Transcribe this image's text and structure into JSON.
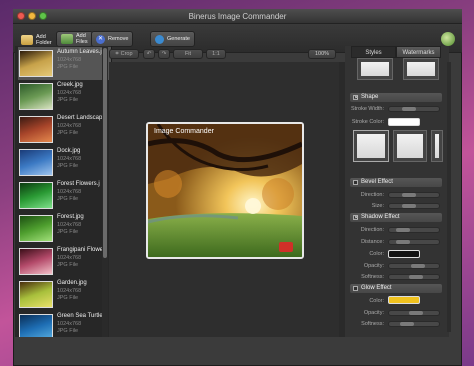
{
  "window": {
    "title": "Binerus Image Commander"
  },
  "toolbar": {
    "add_folder": "Add\nFolder",
    "add_files": "Add\nFiles",
    "remove": "Remove",
    "generate": "Generate"
  },
  "files": [
    {
      "name": "Autumn Leaves.j",
      "size": "1024x768",
      "type": "JPG File",
      "colors": [
        "#2b1a0a",
        "#c7a24a",
        "#e5c978"
      ]
    },
    {
      "name": "Creek.jpg",
      "size": "1024x768",
      "type": "JPG File",
      "colors": [
        "#2d5a2a",
        "#6b9a54",
        "#d9e3c2"
      ]
    },
    {
      "name": "Desert Landscap",
      "size": "1024x768",
      "type": "JPG File",
      "colors": [
        "#3a1a12",
        "#a8452a",
        "#e5894e"
      ]
    },
    {
      "name": "Dock.jpg",
      "size": "1024x768",
      "type": "JPG File",
      "colors": [
        "#1a3b78",
        "#3c7ac4",
        "#9ec4ee"
      ]
    },
    {
      "name": "Forest Flowers.j",
      "size": "1024x768",
      "type": "JPG File",
      "colors": [
        "#0c3b10",
        "#2a9a34",
        "#7ee08a"
      ]
    },
    {
      "name": "Forest.jpg",
      "size": "1024x768",
      "type": "JPG File",
      "colors": [
        "#1c4e12",
        "#4e9e2e",
        "#a2e07a"
      ]
    },
    {
      "name": "Frangipani Flowe",
      "size": "1024x768",
      "type": "JPG File",
      "colors": [
        "#3a0e18",
        "#b44a6a",
        "#f2c0c8"
      ]
    },
    {
      "name": "Garden.jpg",
      "size": "1024x768",
      "type": "JPG File",
      "colors": [
        "#4a2e0e",
        "#a8c03c",
        "#e8e06a"
      ]
    },
    {
      "name": "Green Sea Turtle",
      "size": "1024x768",
      "type": "JPG File",
      "colors": [
        "#0a2e56",
        "#1e6eb4",
        "#5ab0e2"
      ]
    }
  ],
  "edit": {
    "crop": "Crop",
    "fit": "Fit",
    "ratio": "1:1",
    "zoom": "100%"
  },
  "watermark_text": "Image Commander",
  "panel": {
    "tabs": [
      "Styles",
      "Watermarks"
    ],
    "shape": {
      "title": "Shape",
      "stroke_width": "Stroke Width:",
      "stroke_color": "Stroke Color:",
      "stroke_value": 0.35
    },
    "bevel": {
      "title": "Bevel Effect",
      "direction": "Direction:",
      "size": "Size:",
      "direction_value": 0.35,
      "size_value": 0.35
    },
    "shadow": {
      "title": "Shadow Effect",
      "direction": "Direction:",
      "distance": "Distance:",
      "color": "Color:",
      "opacity": "Opacity:",
      "softness": "Softness:",
      "direction_value": 0.2,
      "distance_value": 0.2,
      "opacity_value": 0.6,
      "softness_value": 0.55
    },
    "glow": {
      "title": "Glow Effect",
      "color": "Color:",
      "opacity": "Opacity:",
      "softness": "Softness:",
      "opacity_value": 0.55,
      "softness_value": 0.3
    }
  },
  "colors": {
    "stroke": "#ffffff",
    "shadow": "#111111",
    "glow": "#f0c21e"
  }
}
